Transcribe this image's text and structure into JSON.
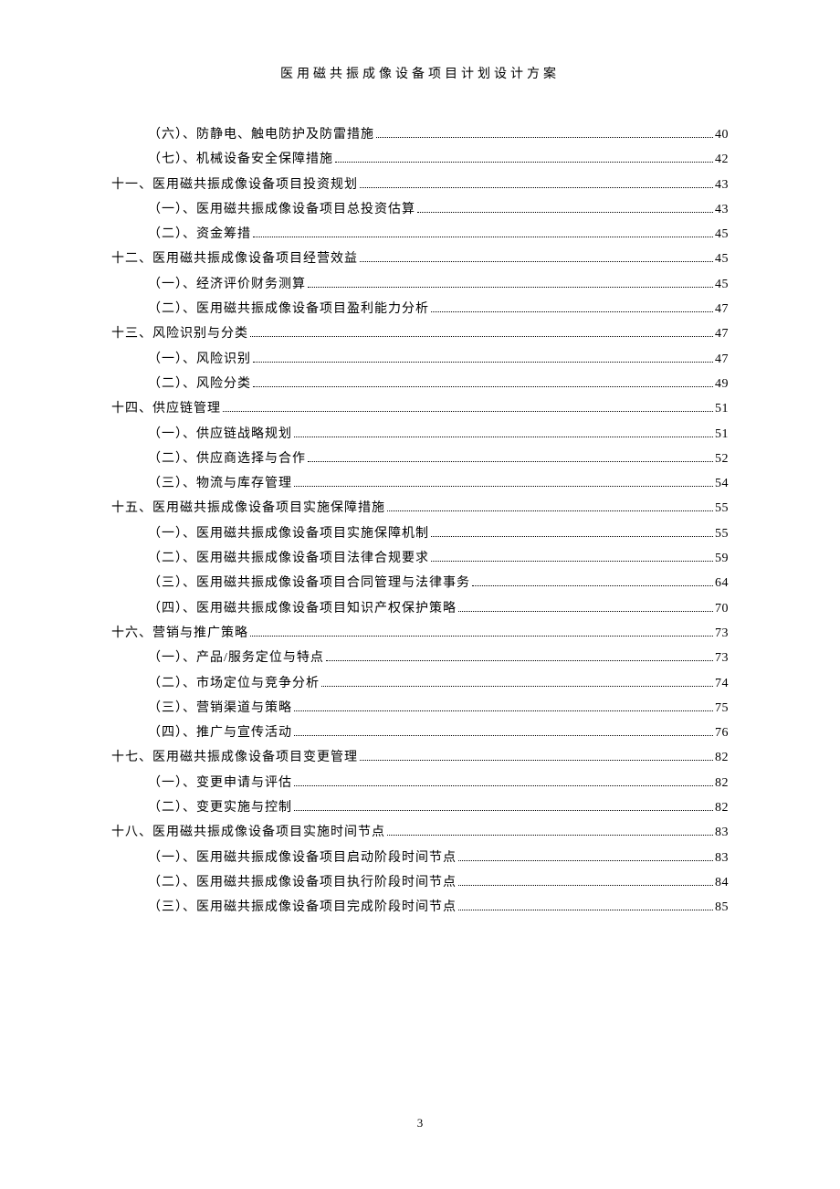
{
  "header": {
    "title": "医用磁共振成像设备项目计划设计方案"
  },
  "toc": [
    {
      "label": "（六）、防静电、触电防护及防雷措施",
      "page": "40",
      "level": 2
    },
    {
      "label": "（七）、机械设备安全保障措施",
      "page": "42",
      "level": 2
    },
    {
      "label": "十一、医用磁共振成像设备项目投资规划",
      "page": "43",
      "level": 1
    },
    {
      "label": "（一）、医用磁共振成像设备项目总投资估算",
      "page": "43",
      "level": 2
    },
    {
      "label": "（二）、资金筹措",
      "page": "45",
      "level": 2
    },
    {
      "label": "十二、医用磁共振成像设备项目经营效益",
      "page": "45",
      "level": 1
    },
    {
      "label": "（一）、经济评价财务测算",
      "page": "45",
      "level": 2
    },
    {
      "label": "（二）、医用磁共振成像设备项目盈利能力分析",
      "page": "47",
      "level": 2
    },
    {
      "label": "十三、风险识别与分类",
      "page": "47",
      "level": 1
    },
    {
      "label": "（一）、风险识别",
      "page": "47",
      "level": 2
    },
    {
      "label": "（二）、风险分类",
      "page": "49",
      "level": 2
    },
    {
      "label": "十四、供应链管理",
      "page": "51",
      "level": 1
    },
    {
      "label": "（一）、供应链战略规划",
      "page": "51",
      "level": 2
    },
    {
      "label": "（二）、供应商选择与合作",
      "page": "52",
      "level": 2
    },
    {
      "label": "（三）、物流与库存管理",
      "page": "54",
      "level": 2
    },
    {
      "label": "十五、医用磁共振成像设备项目实施保障措施",
      "page": "55",
      "level": 1
    },
    {
      "label": "（一）、医用磁共振成像设备项目实施保障机制",
      "page": "55",
      "level": 2
    },
    {
      "label": "（二）、医用磁共振成像设备项目法律合规要求",
      "page": "59",
      "level": 2
    },
    {
      "label": "（三）、医用磁共振成像设备项目合同管理与法律事务",
      "page": "64",
      "level": 2
    },
    {
      "label": "（四）、医用磁共振成像设备项目知识产权保护策略",
      "page": "70",
      "level": 2
    },
    {
      "label": "十六、营销与推广策略",
      "page": "73",
      "level": 1
    },
    {
      "label": "（一）、产品/服务定位与特点",
      "page": "73",
      "level": 2
    },
    {
      "label": "（二）、市场定位与竞争分析",
      "page": "74",
      "level": 2
    },
    {
      "label": "（三）、营销渠道与策略",
      "page": "75",
      "level": 2
    },
    {
      "label": "（四）、推广与宣传活动",
      "page": "76",
      "level": 2
    },
    {
      "label": "十七、医用磁共振成像设备项目变更管理",
      "page": "82",
      "level": 1
    },
    {
      "label": "（一）、变更申请与评估",
      "page": "82",
      "level": 2
    },
    {
      "label": "（二）、变更实施与控制",
      "page": "82",
      "level": 2
    },
    {
      "label": "十八、医用磁共振成像设备项目实施时间节点",
      "page": "83",
      "level": 1
    },
    {
      "label": "（一）、医用磁共振成像设备项目启动阶段时间节点",
      "page": "83",
      "level": 2
    },
    {
      "label": "（二）、医用磁共振成像设备项目执行阶段时间节点",
      "page": "84",
      "level": 2
    },
    {
      "label": "（三）、医用磁共振成像设备项目完成阶段时间节点",
      "page": "85",
      "level": 2
    }
  ],
  "footer": {
    "page_number": "3"
  }
}
